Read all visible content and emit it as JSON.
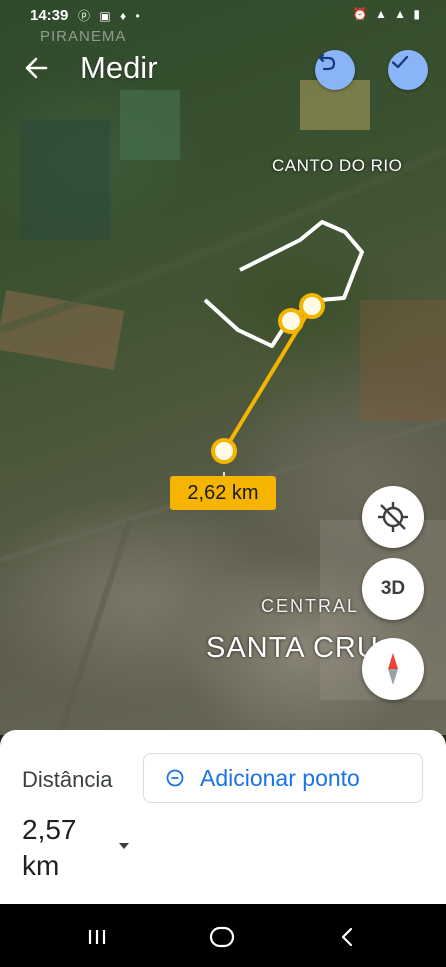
{
  "status_bar": {
    "time": "14:39",
    "left_icons": "ⓟ ▣ ♦ •",
    "right_icons": "⏰ ▲ ▲ ▮"
  },
  "map": {
    "top_place_label": "PIRANEMA",
    "place_labels": {
      "canto_do_rio": "CANTO DO RIO",
      "central": "CENTRAL",
      "santa_cruz": "SANTA CRU"
    },
    "measure_distance_label": "2,62 km",
    "colors": {
      "measure_line": "#f4b400",
      "boundary_line": "#ffffff",
      "button_blue": "#8ab4f8",
      "compass_red": "#ea4335"
    }
  },
  "header": {
    "title": "Medir",
    "back_icon": "arrow-left-icon",
    "undo_icon": "undo-icon",
    "done_icon": "check-icon"
  },
  "fabs": {
    "location_icon": "location-off-icon",
    "three_d_label": "3D",
    "compass_icon": "compass-icon"
  },
  "bottom_sheet": {
    "distance_label": "Distância",
    "add_point_label": "Adicionar ponto",
    "add_point_icon": "plus-circle-icon",
    "distance_value": "2,57",
    "distance_unit": "km",
    "unit_dropdown_icon": "chevron-down-icon"
  },
  "nav_bar": {
    "recents_icon": "recents-icon",
    "home_icon": "home-icon",
    "back_icon": "back-chevron-icon"
  }
}
